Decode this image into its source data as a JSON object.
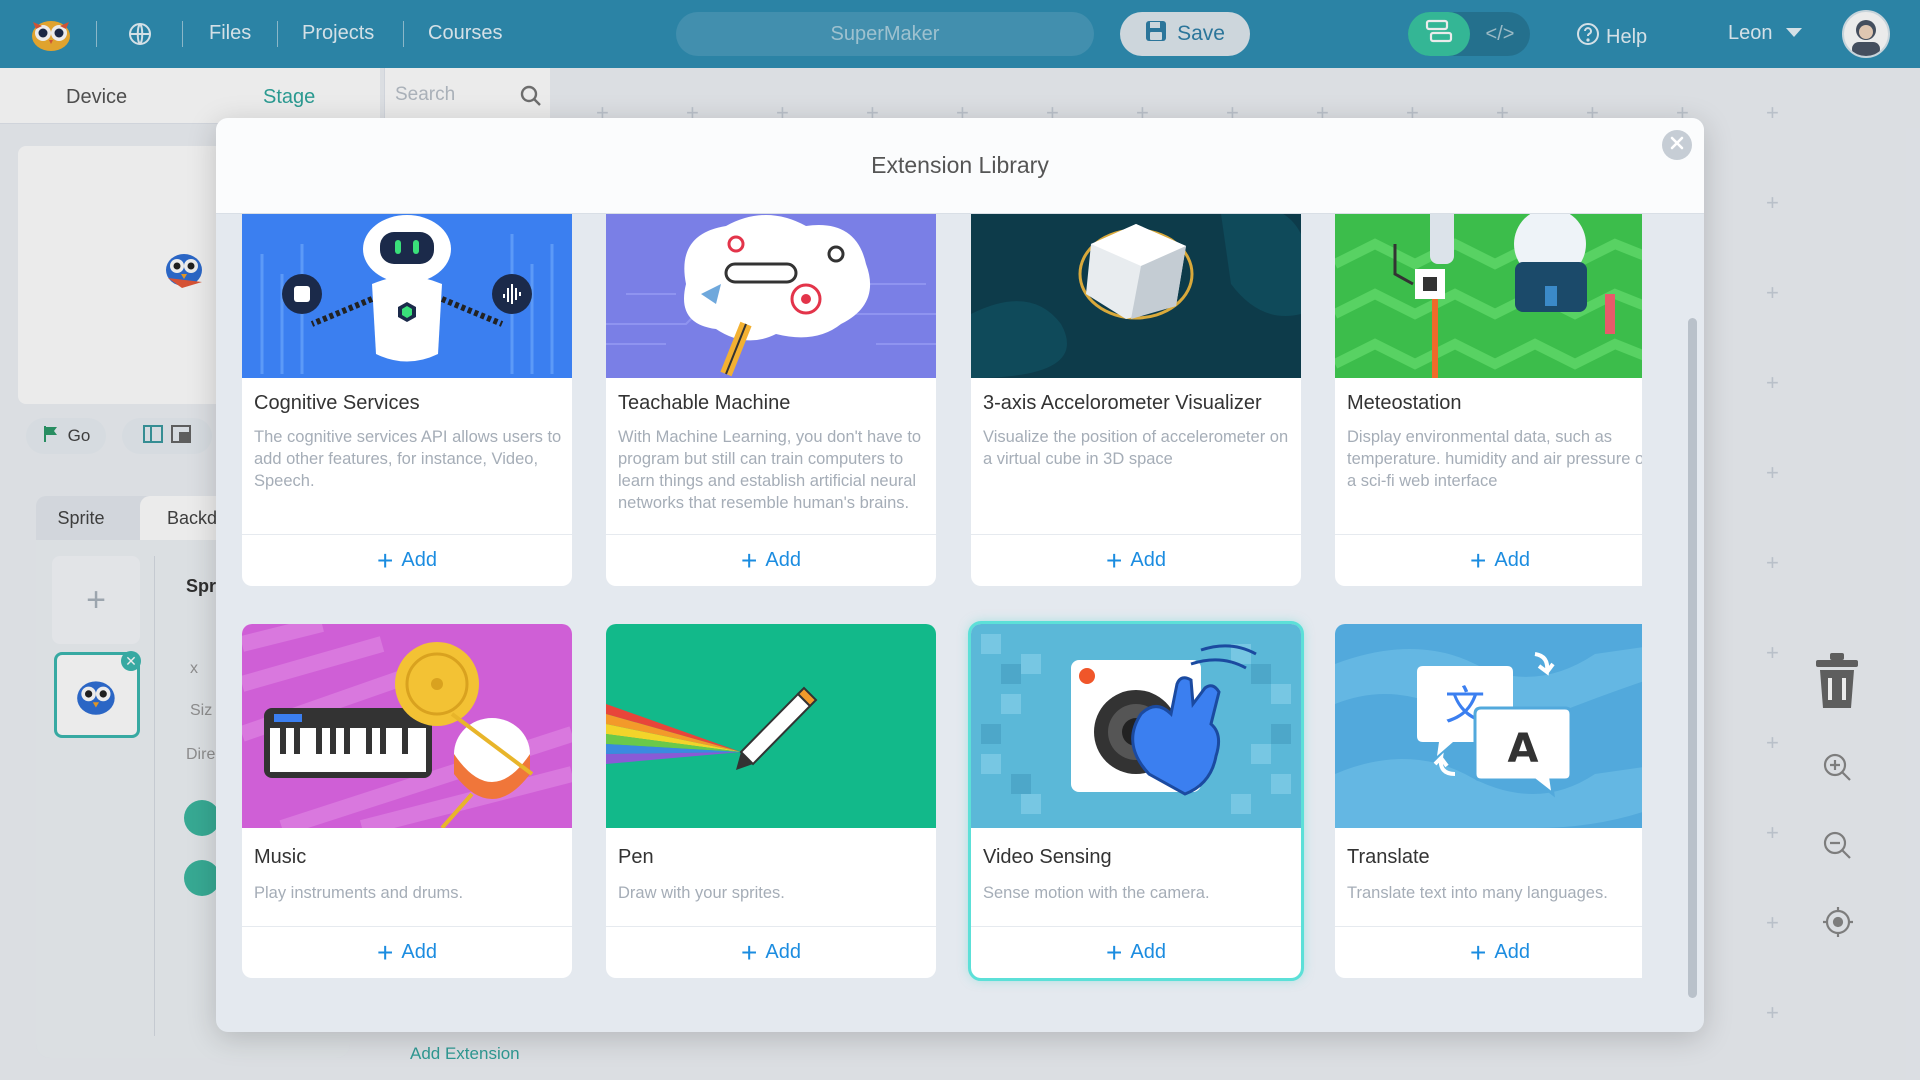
{
  "topbar": {
    "links": [
      "Files",
      "Projects",
      "Courses"
    ],
    "project_name": "SuperMaker",
    "save_label": "Save",
    "mode_code_label": "</>",
    "help_label": "Help",
    "user_name": "Leon"
  },
  "left_panel": {
    "tabs": [
      "Device",
      "Stage"
    ],
    "search_placeholder": "Search",
    "go_label": "Go",
    "sprite_tabs": [
      "Sprite",
      "Backdr"
    ],
    "sprite_fields": [
      "Spr",
      "x",
      "Siz",
      "Dire"
    ],
    "add_extension_label": "Add Extension"
  },
  "modal": {
    "title": "Extension Library",
    "add_label": "Add",
    "cards": [
      {
        "title": "Cognitive Services",
        "desc": "The cognitive services API allows users to add other features, for instance, Video, Speech.",
        "bg": "#3b7ff0"
      },
      {
        "title": "Teachable Machine",
        "desc": "With Machine Learning, you don't have to program but still can train computers to learn things and establish artificial neural networks that resemble human's brains.",
        "bg": "#7a7fe6"
      },
      {
        "title": "3-axis Accelorometer Visualizer",
        "desc": "Visualize the position of accelerometer on a virtual cube in 3D space",
        "bg": "#0d3b4a"
      },
      {
        "title": "Meteostation",
        "desc": "Display environmental data, such as temperature. humidity and air pressure on a sci-fi web interface",
        "bg": "#3cbd4b"
      },
      {
        "title": "Music",
        "desc": "Play instruments and drums.",
        "bg": "#cf5fd6"
      },
      {
        "title": "Pen",
        "desc": "Draw with your sprites.",
        "bg": "#12b98a"
      },
      {
        "title": "Video Sensing",
        "desc": "Sense motion with the camera.",
        "bg": "#5bb8d8"
      },
      {
        "title": "Translate",
        "desc": "Translate text into many languages.",
        "bg": "#52a9dc"
      }
    ]
  }
}
